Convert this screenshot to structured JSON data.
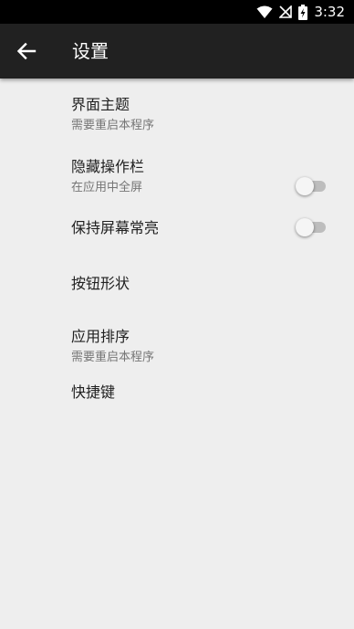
{
  "statusbar": {
    "time": "3:32",
    "icons": [
      "wifi-icon",
      "signal-off-icon",
      "battery-charging-icon"
    ]
  },
  "toolbar": {
    "title": "设置",
    "back_icon": "arrow-back-icon"
  },
  "settings": [
    {
      "title": "界面主题",
      "subtitle": "需要重启本程序"
    },
    {
      "title": "隐藏操作栏",
      "subtitle": "在应用中全屏",
      "toggle": false
    },
    {
      "title": "保持屏幕常亮",
      "toggle": false
    },
    {
      "title": "按钮形状"
    },
    {
      "title": "应用排序",
      "subtitle": "需要重启本程序"
    },
    {
      "title": "快捷键"
    }
  ],
  "colors": {
    "background": "#eeeeee",
    "toolbar": "#212121",
    "statusbar": "#000000",
    "primary_text": "#212121",
    "secondary_text": "#757575",
    "toggle_track_off": "#bdbdbd",
    "toggle_thumb_off": "#f5f5f5"
  }
}
